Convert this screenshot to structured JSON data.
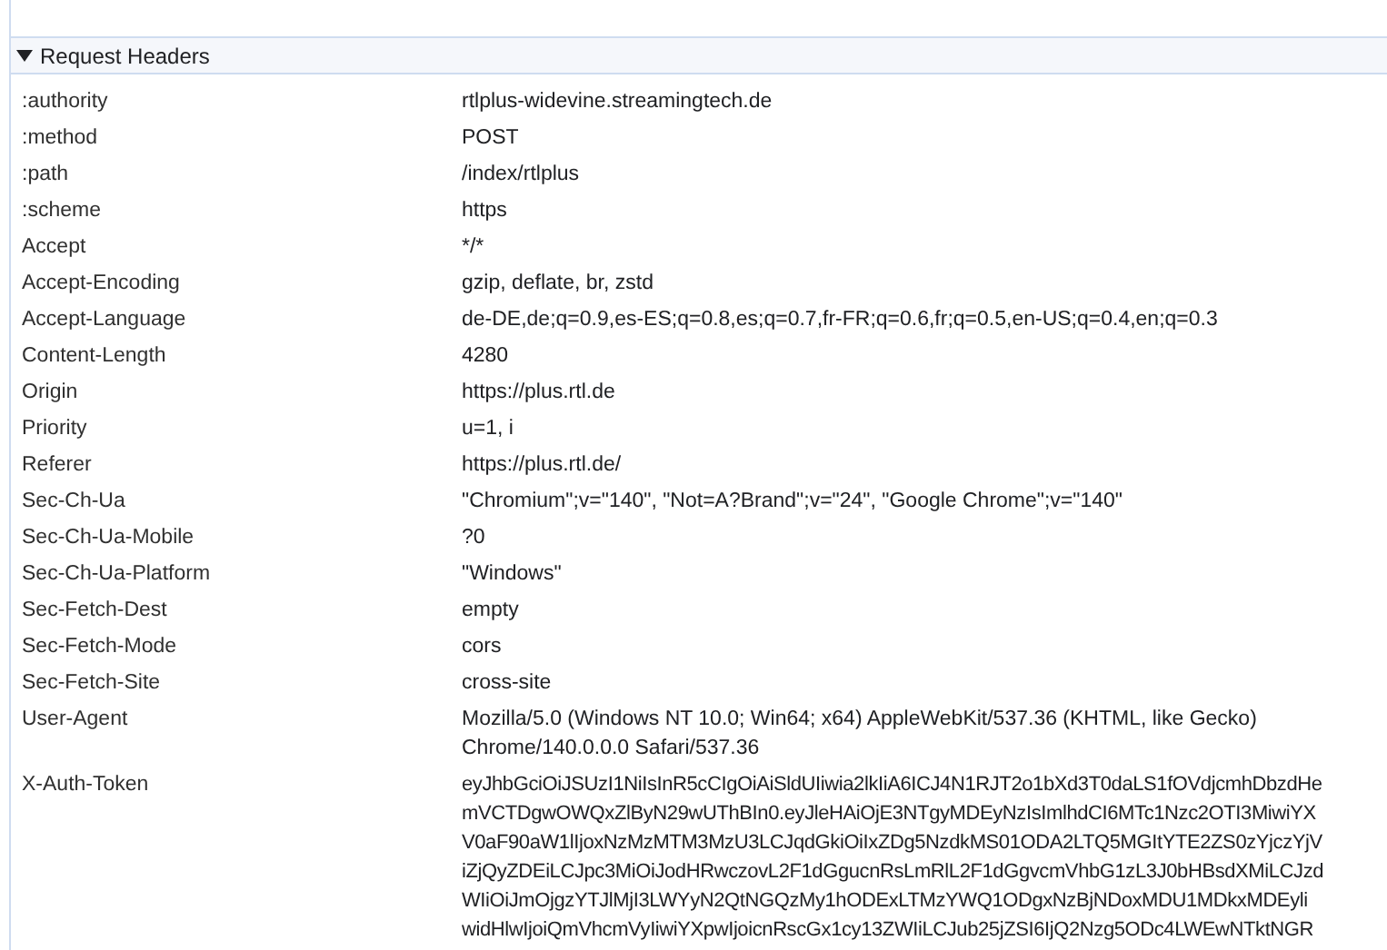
{
  "section": {
    "title": "Request Headers",
    "expanded": true
  },
  "headers": [
    {
      "name": ":authority",
      "value_lines": [
        "rtlplus-widevine.streamingtech.de"
      ]
    },
    {
      "name": ":method",
      "value_lines": [
        "POST"
      ]
    },
    {
      "name": ":path",
      "value_lines": [
        "/index/rtlplus"
      ]
    },
    {
      "name": ":scheme",
      "value_lines": [
        "https"
      ]
    },
    {
      "name": "Accept",
      "value_lines": [
        "*/*"
      ]
    },
    {
      "name": "Accept-Encoding",
      "value_lines": [
        "gzip, deflate, br, zstd"
      ]
    },
    {
      "name": "Accept-Language",
      "value_lines": [
        "de-DE,de;q=0.9,es-ES;q=0.8,es;q=0.7,fr-FR;q=0.6,fr;q=0.5,en-US;q=0.4,en;q=0.3"
      ]
    },
    {
      "name": "Content-Length",
      "value_lines": [
        "4280"
      ]
    },
    {
      "name": "Origin",
      "value_lines": [
        "https://plus.rtl.de"
      ]
    },
    {
      "name": "Priority",
      "value_lines": [
        "u=1, i"
      ]
    },
    {
      "name": "Referer",
      "value_lines": [
        "https://plus.rtl.de/"
      ]
    },
    {
      "name": "Sec-Ch-Ua",
      "value_lines": [
        "\"Chromium\";v=\"140\", \"Not=A?Brand\";v=\"24\", \"Google Chrome\";v=\"140\""
      ]
    },
    {
      "name": "Sec-Ch-Ua-Mobile",
      "value_lines": [
        "?0"
      ]
    },
    {
      "name": "Sec-Ch-Ua-Platform",
      "value_lines": [
        "\"Windows\""
      ]
    },
    {
      "name": "Sec-Fetch-Dest",
      "value_lines": [
        "empty"
      ]
    },
    {
      "name": "Sec-Fetch-Mode",
      "value_lines": [
        "cors"
      ]
    },
    {
      "name": "Sec-Fetch-Site",
      "value_lines": [
        "cross-site"
      ]
    },
    {
      "name": "User-Agent",
      "value_lines": [
        "Mozilla/5.0 (Windows NT 10.0; Win64; x64) AppleWebKit/537.36 (KHTML, like Gecko)",
        "Chrome/140.0.0.0 Safari/537.36"
      ]
    },
    {
      "name": "X-Auth-Token",
      "value_lines": [
        "eyJhbGciOiJSUzI1NiIsInR5cCIgOiAiSldUIiwia2lkIiA6ICJ4N1RJT2o1bXd3T0daLS1fOVdjcmhDbzdHe",
        "mVCTDgwOWQxZlByN29wUThBIn0.eyJleHAiOjE3NTgyMDEyNzIsImlhdCI6MTc1Nzc2OTI3MiwiYX",
        "V0aF90aW1lIjoxNzMzMTM3MzU3LCJqdGkiOiIxZDg5NzdkMS01ODA2LTQ5MGItYTE2ZS0zYjczYjV",
        "iZjQyZDEiLCJpc3MiOiJodHRwczovL2F1dGgucnRsLmRlL2F1dGgvcmVhbG1zL3J0bHBsdXMiLCJzd",
        "WIiOiJmOjgzYTJlMjI3LWYyN2QtNGQzMy1hODExLTMzYWQ1ODgxNzBjNDoxMDU1MDkxMDEyli",
        "widHlwIjoiQmVhcmVyIiwiYXpwIjoicnRscGx1cy13ZWIiLCJub25jZSI6IjQ2Nzg5ODc4LWEwNTktNGR"
      ]
    }
  ]
}
